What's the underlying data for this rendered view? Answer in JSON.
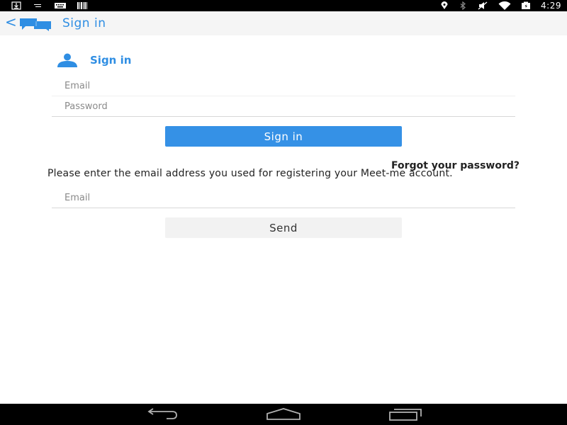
{
  "status_bar": {
    "time": "4:29",
    "left_icons": [
      "download-icon",
      "notification-icon",
      "keyboard-icon",
      "barcode-icon"
    ],
    "right_icons": [
      "location-icon",
      "bluetooth-icon",
      "mute-icon",
      "wifi-icon",
      "battery-icon"
    ]
  },
  "action_bar": {
    "title": "Sign in",
    "back_glyph": "<"
  },
  "signin": {
    "heading": "Sign in",
    "email_placeholder": "Email",
    "password_placeholder": "Password",
    "button_label": "Sign in"
  },
  "reset": {
    "forgot_link": "Forgot your password?",
    "help_text": "Please enter the email address you used for registering your Meet-me account.",
    "email_placeholder": "Email",
    "send_label": "Send"
  },
  "colors": {
    "accent": "#2f8ee3",
    "button_primary": "#3591e6",
    "button_secondary": "#f2f2f2",
    "system_bars": "#000000"
  },
  "nav_bar": {
    "buttons": [
      "back-icon",
      "home-icon",
      "recents-icon"
    ]
  }
}
